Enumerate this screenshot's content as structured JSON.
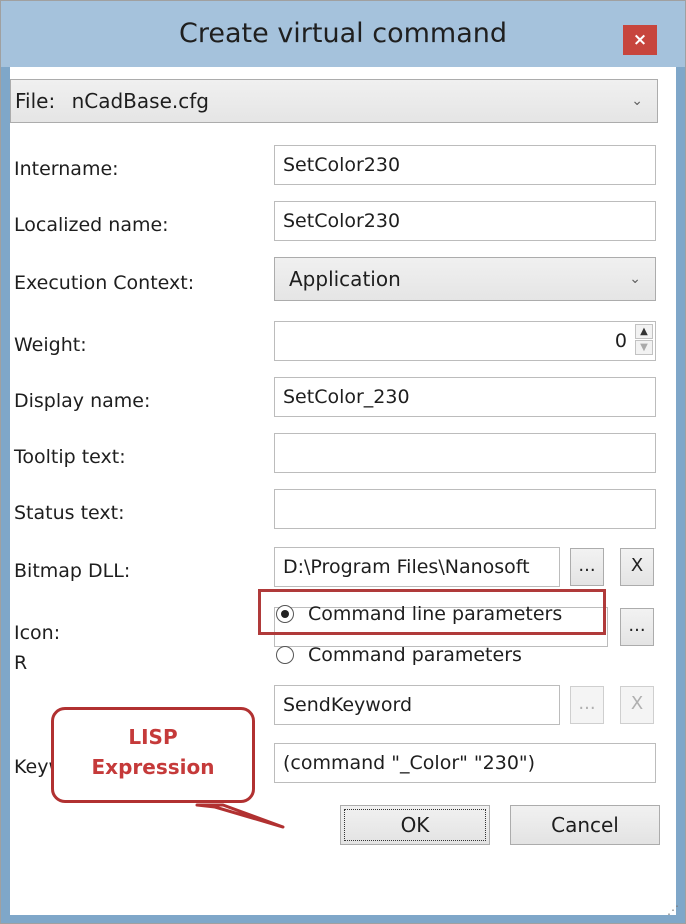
{
  "window": {
    "title": "Create virtual command",
    "close_label": "×"
  },
  "file": {
    "label": "File:",
    "value": "nCadBase.cfg"
  },
  "fields": {
    "intername": {
      "label": "Intername:",
      "value": "SetColor230"
    },
    "localized": {
      "label": "Localized name:",
      "value": "SetColor230"
    },
    "context": {
      "label": "Execution Context:",
      "value": "Application"
    },
    "weight": {
      "label": "Weight:",
      "value": "0"
    },
    "display": {
      "label": "Display name:",
      "value": "SetColor_230"
    },
    "tooltip": {
      "label": "Tooltip text:",
      "value": ""
    },
    "status": {
      "label": "Status text:",
      "value": ""
    },
    "bitmap": {
      "label": "Bitmap DLL:",
      "value": "D:\\Program Files\\Nanosoft"
    },
    "icon": {
      "label": "Icon:",
      "value": ""
    },
    "r_partial": {
      "label": "R"
    },
    "command": {
      "value": "SendKeyword"
    },
    "keyword": {
      "label": "Keyword:",
      "value": "(command \"_Color\" \"230\")"
    }
  },
  "radios": {
    "command_line": {
      "label": "Command line parameters",
      "selected": true
    },
    "command_params": {
      "label": "Command parameters",
      "selected": false
    }
  },
  "buttons": {
    "browse": "...",
    "clear": "X",
    "ok": "OK",
    "cancel": "Cancel"
  },
  "callout": {
    "line1": "LISP",
    "line2": "Expression"
  },
  "colors": {
    "accent_red": "#b03a3a",
    "titlebar": "#a5c2dc"
  }
}
